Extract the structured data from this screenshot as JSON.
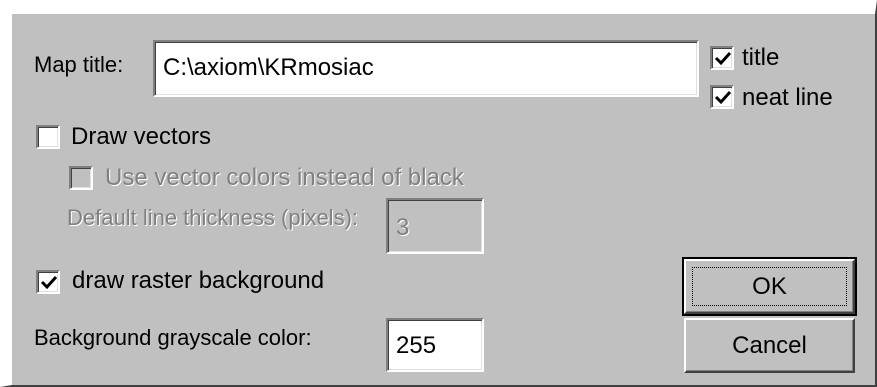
{
  "map_title": {
    "label": "Map title:",
    "value": "C:\\axiom\\KRmosiac"
  },
  "options": {
    "title": {
      "label": "title",
      "checked": true
    },
    "neat_line": {
      "label": "neat line",
      "checked": true
    }
  },
  "vectors": {
    "draw_label": "Draw vectors",
    "draw_checked": false,
    "use_colors_label": "Use vector colors instead of black",
    "use_colors_checked": false,
    "line_thickness_label": "Default line thickness (pixels):",
    "line_thickness_value": "3"
  },
  "raster": {
    "draw_label": "draw raster background",
    "draw_checked": true,
    "grayscale_label": "Background grayscale color:",
    "grayscale_value": "255"
  },
  "buttons": {
    "ok": "OK",
    "cancel": "Cancel"
  }
}
